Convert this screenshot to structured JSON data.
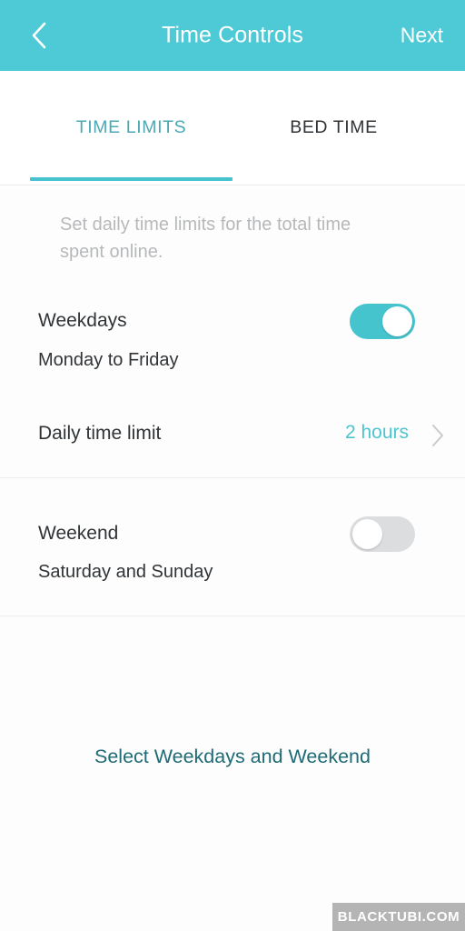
{
  "header": {
    "back_icon": "chevron-left-icon",
    "title": "Time Controls",
    "next_label": "Next",
    "background_color": "#4ECAD6",
    "text_color": "#FFFFFF"
  },
  "tabs": {
    "active_index": 0,
    "items": [
      {
        "label": "TIME LIMITS",
        "active": true,
        "color": "#4AA9B5"
      },
      {
        "label": "BED TIME",
        "active": false,
        "color": "#2F3335"
      }
    ],
    "indicator_color": "#46C2CE"
  },
  "main": {
    "description": "Set daily time limits for the total time spent online.",
    "sections": [
      {
        "title": "Weekdays",
        "subtitle": "Monday to Friday",
        "toggle_state": "on",
        "toggle_on_color": "#45C4CE",
        "rows": [
          {
            "label": "Daily time limit",
            "value": "2 hours",
            "value_color": "#4EC4CF",
            "chevron_icon": "chevron-right-icon"
          }
        ]
      },
      {
        "title": "Weekend",
        "subtitle": "Saturday and Sunday",
        "toggle_state": "off",
        "toggle_off_color": "#DCDDDF",
        "rows": []
      }
    ],
    "select_link_label": "Select Weekdays and Weekend",
    "select_link_color": "#1E6B75"
  },
  "watermark": {
    "text": "BLACKTUBI.COM",
    "background_color": "#B4B4B4",
    "text_color": "#FFFFFF"
  }
}
